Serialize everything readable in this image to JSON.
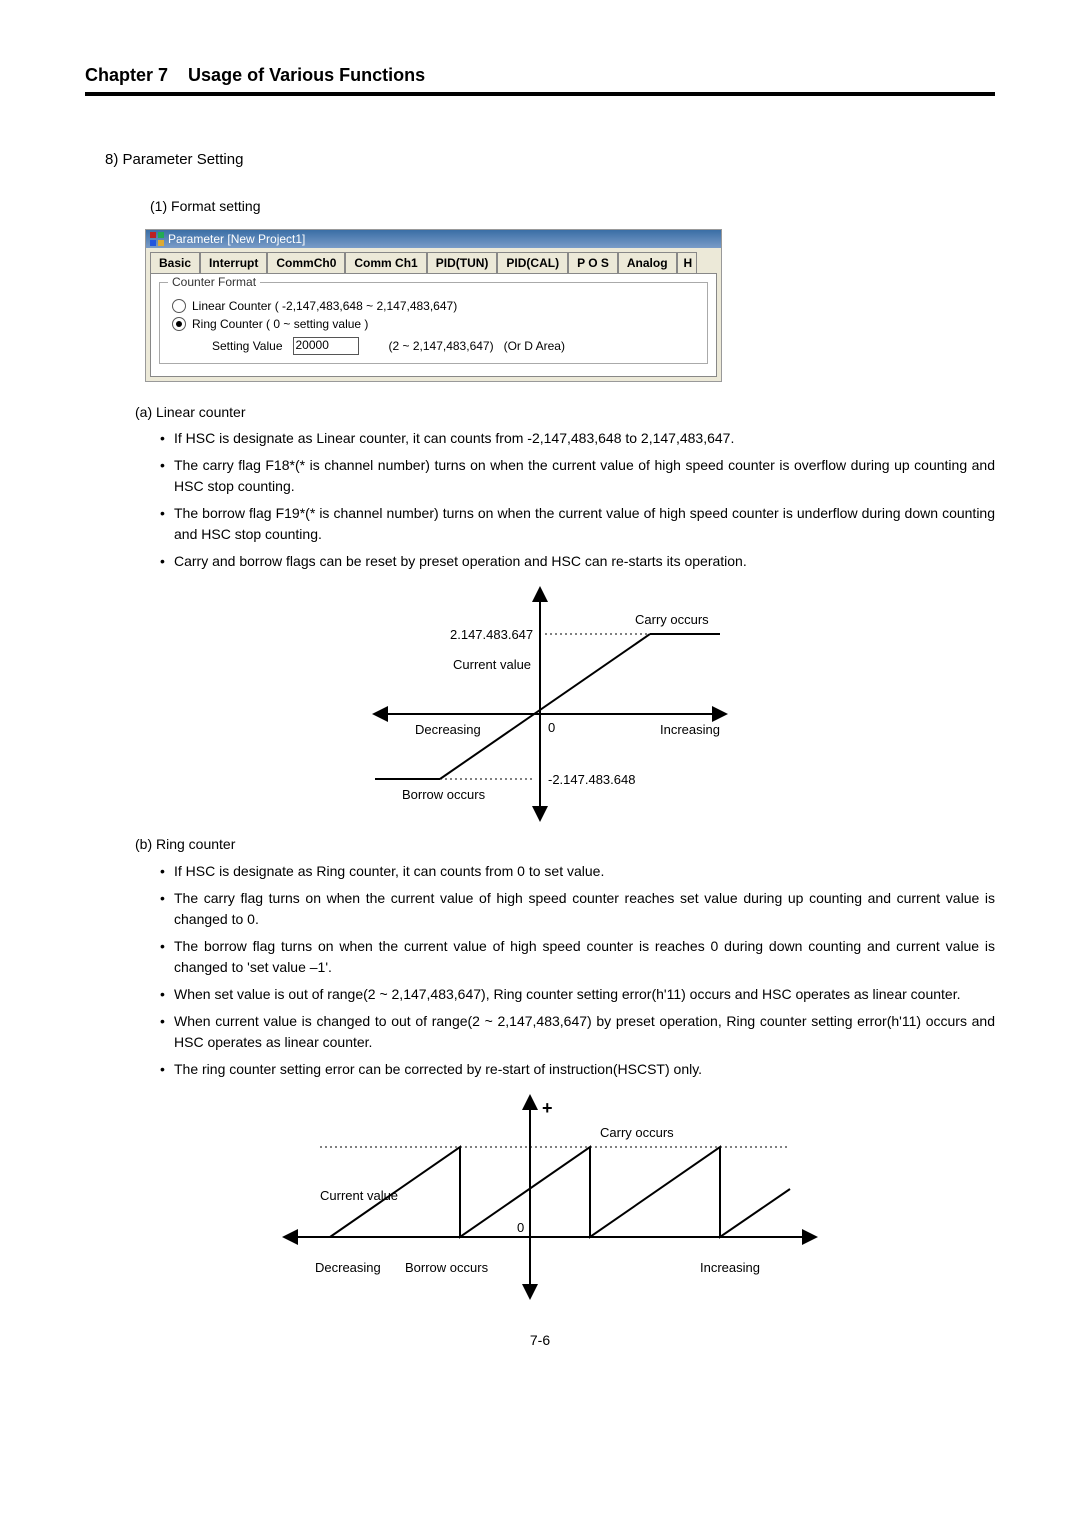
{
  "header": {
    "chapter": "Chapter 7",
    "title": "Usage of Various Functions"
  },
  "section8": {
    "number": "8)",
    "title": "Parameter Setting",
    "sub1": {
      "number": "(1)",
      "title": "Format setting"
    }
  },
  "mockup": {
    "window_title": "Parameter [New Project1]",
    "tabs": [
      "Basic",
      "Interrupt",
      "CommCh0",
      "Comm Ch1",
      "PID(TUN)",
      "PID(CAL)",
      "P O S",
      "Analog"
    ],
    "tab_extra": "H",
    "group_title": "Counter Format",
    "radio_linear": "Linear Counter ( -2,147,483,648 ~ 2,147,483,647)",
    "radio_ring": "Ring Counter ( 0 ~ setting value )",
    "setting_label": "Setting Value",
    "setting_value": "20000",
    "setting_range": "(2 ~ 2,147,483,647)",
    "setting_area": "(Or D Area)"
  },
  "linear": {
    "heading": "(a) Linear counter",
    "bullets": [
      "If HSC is designate as Linear counter, it can counts from -2,147,483,648 to 2,147,483,647.",
      "The carry flag F18*(* is channel number) turns on when the current value of high speed counter is overflow during up counting and HSC stop counting.",
      "The borrow flag F19*(* is channel number) turns on when the current value of high speed counter is underflow during down counting and HSC stop counting.",
      "Carry and borrow flags can be reset by preset operation and HSC can re-starts its operation."
    ]
  },
  "ring": {
    "heading": "(b) Ring counter",
    "bullets": [
      "If HSC is designate as Ring counter, it can counts from 0 to set value.",
      "The carry flag turns on when the current value of high speed counter reaches set value during up counting and current value is changed to 0.",
      "The borrow flag turns on when the current value of high speed counter is reaches 0 during down counting and current value is changed to 'set value –1'.",
      "When set value is out of range(2 ~ 2,147,483,647), Ring counter setting error(h'11) occurs and HSC operates as linear counter.",
      "When current value is changed to out of range(2 ~ 2,147,483,647) by preset operation, Ring counter setting error(h'11) occurs and HSC operates as linear counter.",
      "The ring counter setting error can be corrected by re-start of instruction(HSCST) only."
    ]
  },
  "diagram1": {
    "top_value": "2.147.483.647",
    "current_value": "Current value",
    "decreasing": "Decreasing",
    "zero": "0",
    "increasing": "Increasing",
    "bottom_value": "-2.147.483.648",
    "carry": "Carry occurs",
    "borrow": "Borrow occurs"
  },
  "diagram2": {
    "plus": "+",
    "carry": "Carry occurs",
    "current_value": "Current value",
    "zero": "0",
    "decreasing": "Decreasing",
    "borrow": "Borrow occurs",
    "increasing": "Increasing"
  },
  "footer": {
    "page": "7-6"
  },
  "chart_data": [
    {
      "type": "diagram",
      "name": "Linear counter behavior",
      "y_max_label": "2.147.483.647",
      "y_min_label": "-2.147.483.648",
      "x_left": "Decreasing",
      "x_right": "Increasing",
      "annotations": [
        "Carry occurs (at +max)",
        "Borrow occurs (at -min)",
        "Current value (diagonal line)",
        "0 (origin)"
      ]
    },
    {
      "type": "diagram",
      "name": "Ring counter behavior",
      "sawtooth_peaks": 3,
      "x_left": "Decreasing",
      "x_right": "Increasing",
      "annotations": [
        "Carry occurs (at peak)",
        "Borrow occurs (at zero)",
        "Current value",
        "0",
        "+"
      ]
    }
  ]
}
